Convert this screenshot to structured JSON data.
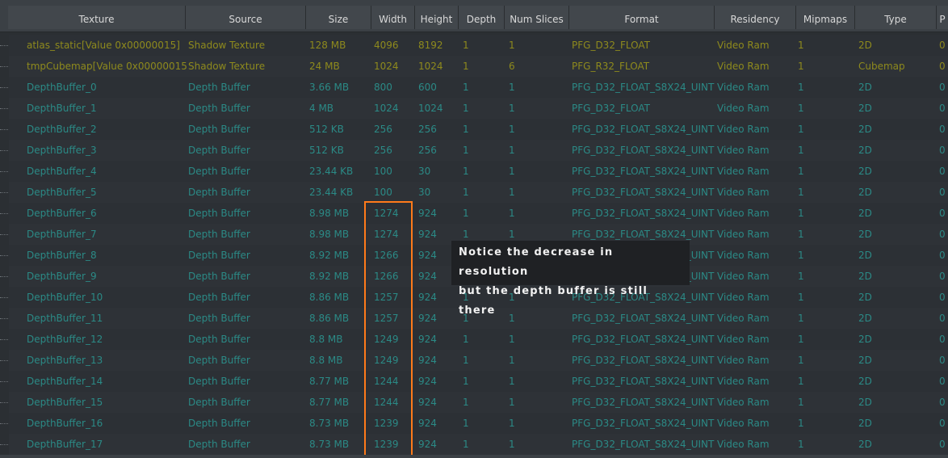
{
  "columns": [
    "Texture",
    "Source",
    "Size",
    "Width",
    "Height",
    "Depth",
    "Num Slices",
    "Format",
    "Residency",
    "Mipmaps",
    "Type",
    "P"
  ],
  "rows": [
    {
      "kind": "shadow",
      "texture": "atlas_static[Value 0x00000015]",
      "source": "Shadow Texture",
      "size": "128 MB",
      "width": "4096",
      "height": "8192",
      "depth": "1",
      "slices": "1",
      "format": "PFG_D32_FLOAT",
      "residency": "Video Ram",
      "mipmaps": "1",
      "type": "2D",
      "p": "0"
    },
    {
      "kind": "shadow",
      "texture": "tmpCubemap[Value 0x00000015]",
      "source": "Shadow Texture",
      "size": "24 MB",
      "width": "1024",
      "height": "1024",
      "depth": "1",
      "slices": "6",
      "format": "PFG_R32_FLOAT",
      "residency": "Video Ram",
      "mipmaps": "1",
      "type": "Cubemap",
      "p": "0"
    },
    {
      "kind": "depth",
      "texture": "DepthBuffer_0",
      "source": "Depth Buffer",
      "size": "3.66 MB",
      "width": "800",
      "height": "600",
      "depth": "1",
      "slices": "1",
      "format": "PFG_D32_FLOAT_S8X24_UINT",
      "residency": "Video Ram",
      "mipmaps": "1",
      "type": "2D",
      "p": "0"
    },
    {
      "kind": "depth",
      "texture": "DepthBuffer_1",
      "source": "Depth Buffer",
      "size": "4 MB",
      "width": "1024",
      "height": "1024",
      "depth": "1",
      "slices": "1",
      "format": "PFG_D32_FLOAT",
      "residency": "Video Ram",
      "mipmaps": "1",
      "type": "2D",
      "p": "0"
    },
    {
      "kind": "depth",
      "texture": "DepthBuffer_2",
      "source": "Depth Buffer",
      "size": "512 KB",
      "width": "256",
      "height": "256",
      "depth": "1",
      "slices": "1",
      "format": "PFG_D32_FLOAT_S8X24_UINT",
      "residency": "Video Ram",
      "mipmaps": "1",
      "type": "2D",
      "p": "0"
    },
    {
      "kind": "depth",
      "texture": "DepthBuffer_3",
      "source": "Depth Buffer",
      "size": "512 KB",
      "width": "256",
      "height": "256",
      "depth": "1",
      "slices": "1",
      "format": "PFG_D32_FLOAT_S8X24_UINT",
      "residency": "Video Ram",
      "mipmaps": "1",
      "type": "2D",
      "p": "0"
    },
    {
      "kind": "depth",
      "texture": "DepthBuffer_4",
      "source": "Depth Buffer",
      "size": "23.44 KB",
      "width": "100",
      "height": "30",
      "depth": "1",
      "slices": "1",
      "format": "PFG_D32_FLOAT_S8X24_UINT",
      "residency": "Video Ram",
      "mipmaps": "1",
      "type": "2D",
      "p": "0"
    },
    {
      "kind": "depth",
      "texture": "DepthBuffer_5",
      "source": "Depth Buffer",
      "size": "23.44 KB",
      "width": "100",
      "height": "30",
      "depth": "1",
      "slices": "1",
      "format": "PFG_D32_FLOAT_S8X24_UINT",
      "residency": "Video Ram",
      "mipmaps": "1",
      "type": "2D",
      "p": "0"
    },
    {
      "kind": "depth",
      "texture": "DepthBuffer_6",
      "source": "Depth Buffer",
      "size": "8.98 MB",
      "width": "1274",
      "height": "924",
      "depth": "1",
      "slices": "1",
      "format": "PFG_D32_FLOAT_S8X24_UINT",
      "residency": "Video Ram",
      "mipmaps": "1",
      "type": "2D",
      "p": "0"
    },
    {
      "kind": "depth",
      "texture": "DepthBuffer_7",
      "source": "Depth Buffer",
      "size": "8.98 MB",
      "width": "1274",
      "height": "924",
      "depth": "1",
      "slices": "1",
      "format": "PFG_D32_FLOAT_S8X24_UINT",
      "residency": "Video Ram",
      "mipmaps": "1",
      "type": "2D",
      "p": "0"
    },
    {
      "kind": "depth",
      "texture": "DepthBuffer_8",
      "source": "Depth Buffer",
      "size": "8.92 MB",
      "width": "1266",
      "height": "924",
      "depth": "1",
      "slices": "1",
      "format": "PFG_D32_FLOAT_S8X24_UINT",
      "residency": "Video Ram",
      "mipmaps": "1",
      "type": "2D",
      "p": "0"
    },
    {
      "kind": "depth",
      "texture": "DepthBuffer_9",
      "source": "Depth Buffer",
      "size": "8.92 MB",
      "width": "1266",
      "height": "924",
      "depth": "1",
      "slices": "1",
      "format": "PFG_D32_FLOAT_S8X24_UINT",
      "residency": "Video Ram",
      "mipmaps": "1",
      "type": "2D",
      "p": "0"
    },
    {
      "kind": "depth",
      "texture": "DepthBuffer_10",
      "source": "Depth Buffer",
      "size": "8.86 MB",
      "width": "1257",
      "height": "924",
      "depth": "1",
      "slices": "1",
      "format": "PFG_D32_FLOAT_S8X24_UINT",
      "residency": "Video Ram",
      "mipmaps": "1",
      "type": "2D",
      "p": "0"
    },
    {
      "kind": "depth",
      "texture": "DepthBuffer_11",
      "source": "Depth Buffer",
      "size": "8.86 MB",
      "width": "1257",
      "height": "924",
      "depth": "1",
      "slices": "1",
      "format": "PFG_D32_FLOAT_S8X24_UINT",
      "residency": "Video Ram",
      "mipmaps": "1",
      "type": "2D",
      "p": "0"
    },
    {
      "kind": "depth",
      "texture": "DepthBuffer_12",
      "source": "Depth Buffer",
      "size": "8.8 MB",
      "width": "1249",
      "height": "924",
      "depth": "1",
      "slices": "1",
      "format": "PFG_D32_FLOAT_S8X24_UINT",
      "residency": "Video Ram",
      "mipmaps": "1",
      "type": "2D",
      "p": "0"
    },
    {
      "kind": "depth",
      "texture": "DepthBuffer_13",
      "source": "Depth Buffer",
      "size": "8.8 MB",
      "width": "1249",
      "height": "924",
      "depth": "1",
      "slices": "1",
      "format": "PFG_D32_FLOAT_S8X24_UINT",
      "residency": "Video Ram",
      "mipmaps": "1",
      "type": "2D",
      "p": "0"
    },
    {
      "kind": "depth",
      "texture": "DepthBuffer_14",
      "source": "Depth Buffer",
      "size": "8.77 MB",
      "width": "1244",
      "height": "924",
      "depth": "1",
      "slices": "1",
      "format": "PFG_D32_FLOAT_S8X24_UINT",
      "residency": "Video Ram",
      "mipmaps": "1",
      "type": "2D",
      "p": "0"
    },
    {
      "kind": "depth",
      "texture": "DepthBuffer_15",
      "source": "Depth Buffer",
      "size": "8.77 MB",
      "width": "1244",
      "height": "924",
      "depth": "1",
      "slices": "1",
      "format": "PFG_D32_FLOAT_S8X24_UINT",
      "residency": "Video Ram",
      "mipmaps": "1",
      "type": "2D",
      "p": "0"
    },
    {
      "kind": "depth",
      "texture": "DepthBuffer_16",
      "source": "Depth Buffer",
      "size": "8.73 MB",
      "width": "1239",
      "height": "924",
      "depth": "1",
      "slices": "1",
      "format": "PFG_D32_FLOAT_S8X24_UINT",
      "residency": "Video Ram",
      "mipmaps": "1",
      "type": "2D",
      "p": "0"
    },
    {
      "kind": "depth",
      "texture": "DepthBuffer_17",
      "source": "Depth Buffer",
      "size": "8.73 MB",
      "width": "1239",
      "height": "924",
      "depth": "1",
      "slices": "1",
      "format": "PFG_D32_FLOAT_S8X24_UINT",
      "residency": "Video Ram",
      "mipmaps": "1",
      "type": "2D",
      "p": "0"
    }
  ],
  "annotation": {
    "line1": "Notice the decrease in resolution",
    "line2": "but the depth buffer is still there",
    "highlight_color": "#ff7a1a"
  },
  "colors": {
    "shadow_text": "#8e8a1d",
    "depth_text": "#2b8a86",
    "header_bg": "#42474c",
    "header_text": "#d8d8d8",
    "row_bg": "#2c3035"
  }
}
